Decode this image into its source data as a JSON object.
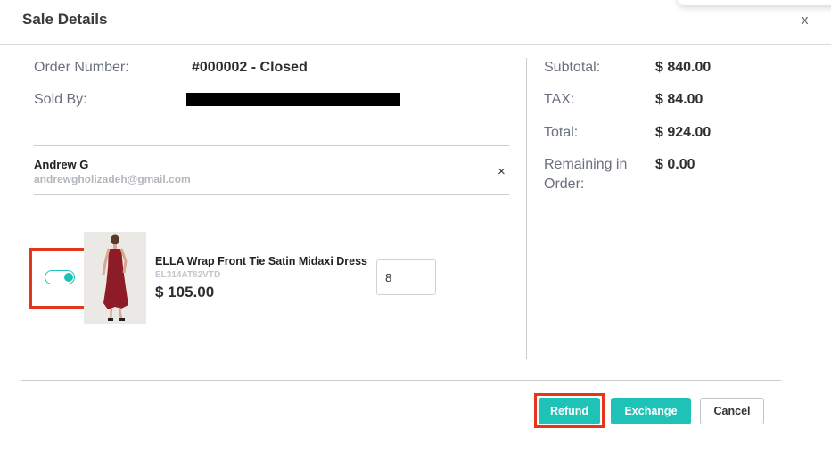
{
  "modal": {
    "title": "Sale Details",
    "close_label": "x"
  },
  "order": {
    "number_label": "Order Number:",
    "number_value": "#000002 - Closed",
    "sold_by_label": "Sold By:"
  },
  "totals": {
    "subtotal_label": "Subtotal:",
    "subtotal_value": "$ 840.00",
    "tax_label": "TAX:",
    "tax_value": "$ 84.00",
    "total_label": "Total:",
    "total_value": "$ 924.00",
    "remaining_label_line1": "Remaining in",
    "remaining_label_line2": "Order:",
    "remaining_value": "$ 0.00"
  },
  "customer": {
    "name": "Andrew G",
    "email": "andrewgholizadeh@gmail.com",
    "remove_label": "×"
  },
  "item": {
    "selected": true,
    "name": "ELLA Wrap Front Tie Satin Midaxi Dress",
    "sku": "EL314AT62VTD",
    "price": "$ 105.00",
    "quantity": "8"
  },
  "actions": {
    "refund_label": "Refund",
    "exchange_label": "Exchange",
    "cancel_label": "Cancel"
  },
  "colors": {
    "accent": "#1fc2b7",
    "highlight": "#e2371c"
  }
}
